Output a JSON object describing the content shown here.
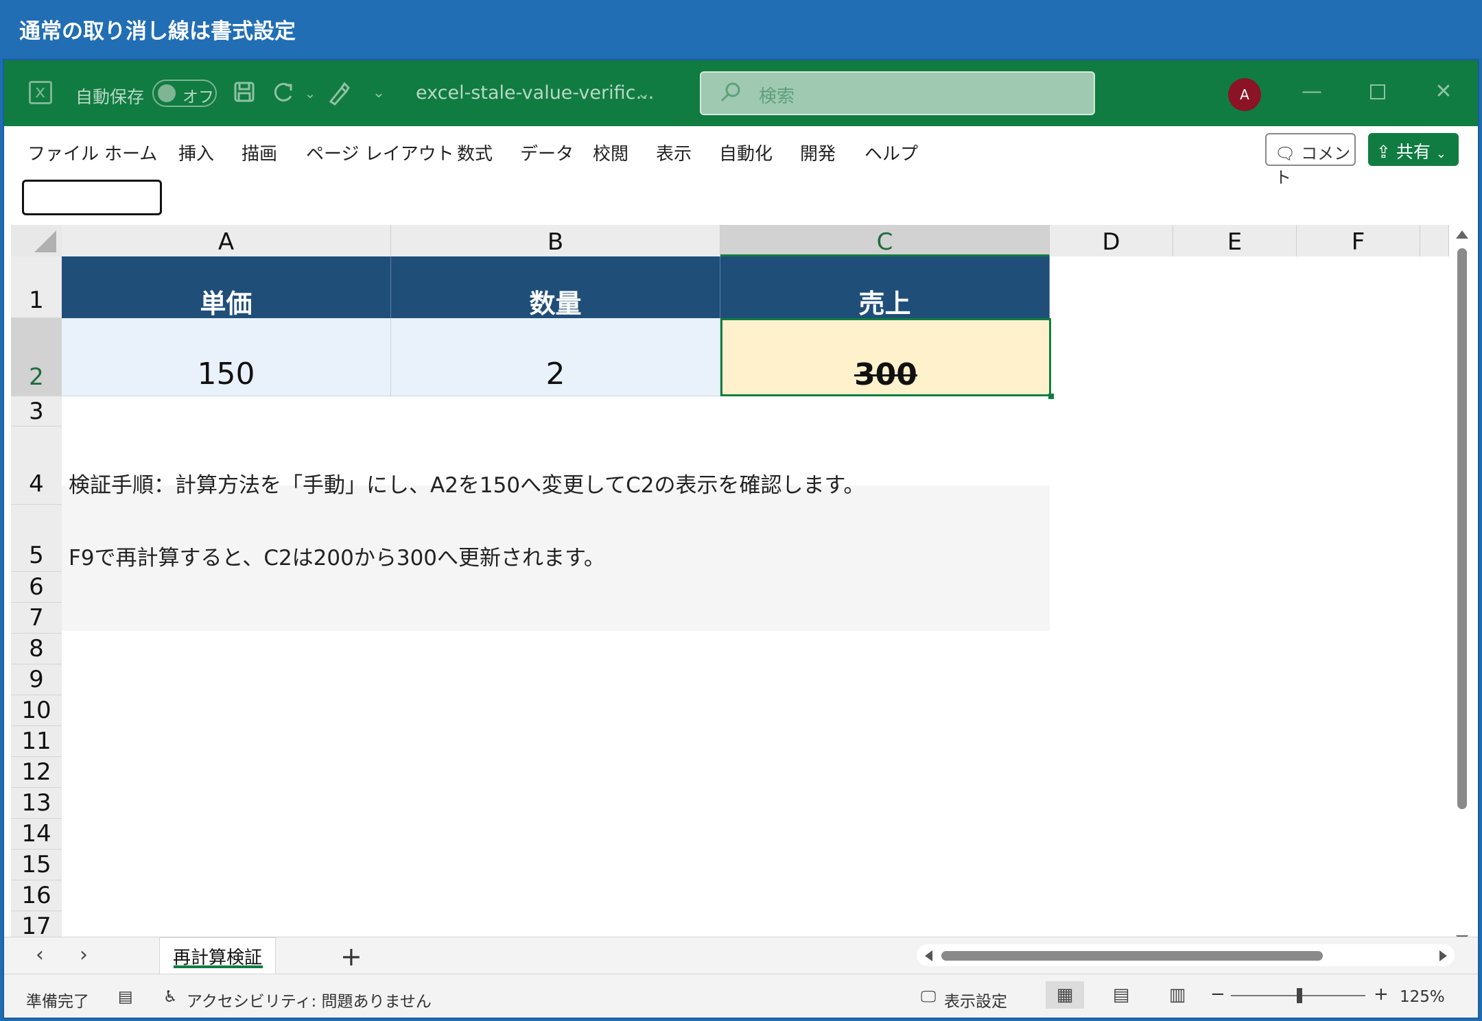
{
  "outer": {
    "title": "通常の取り消し線は書式設定"
  },
  "titlebar": {
    "autosave_label": "自動保存",
    "autosave_state": "オフ",
    "file_name": "excel-stale-value-verific…",
    "search_placeholder": "検索",
    "avatar_initial": "A"
  },
  "ribbon": {
    "tabs": [
      "ファイル",
      "ホーム",
      "挿入",
      "描画",
      "ページ レイアウト",
      "数式",
      "データ",
      "校閲",
      "表示",
      "自動化",
      "開発",
      "ヘルプ"
    ],
    "comment_label": "コメント",
    "share_label": "共有"
  },
  "grid": {
    "columns": [
      "A",
      "B",
      "C",
      "D",
      "E",
      "F"
    ],
    "selected_column": "C",
    "rows": [
      "1",
      "2",
      "3",
      "4",
      "5",
      "6",
      "7",
      "8",
      "9",
      "10",
      "11",
      "12",
      "13",
      "14",
      "15",
      "16",
      "17"
    ],
    "selected_row": "2",
    "headers": {
      "a1": "単価",
      "b1": "数量",
      "c1": "売上"
    },
    "values": {
      "a2": "150",
      "b2": "2",
      "c2": "300"
    },
    "notes": {
      "row4": "検証手順：計算方法を「手動」にし、A2を150へ変更してC2の表示を確認します。",
      "row5": "F9で再計算すると、C2は200から300へ更新されます。"
    }
  },
  "colors": {
    "excel_green": "#107c41",
    "header_fill": "#1f4e79",
    "data_fill": "#e9f2fb",
    "selected_fill": "#fff1cc"
  },
  "sheets": {
    "active": "再計算検証"
  },
  "status": {
    "ready": "準備完了",
    "accessibility": "アクセシビリティ: 問題ありません",
    "display_settings": "表示設定",
    "zoom": "125%"
  }
}
